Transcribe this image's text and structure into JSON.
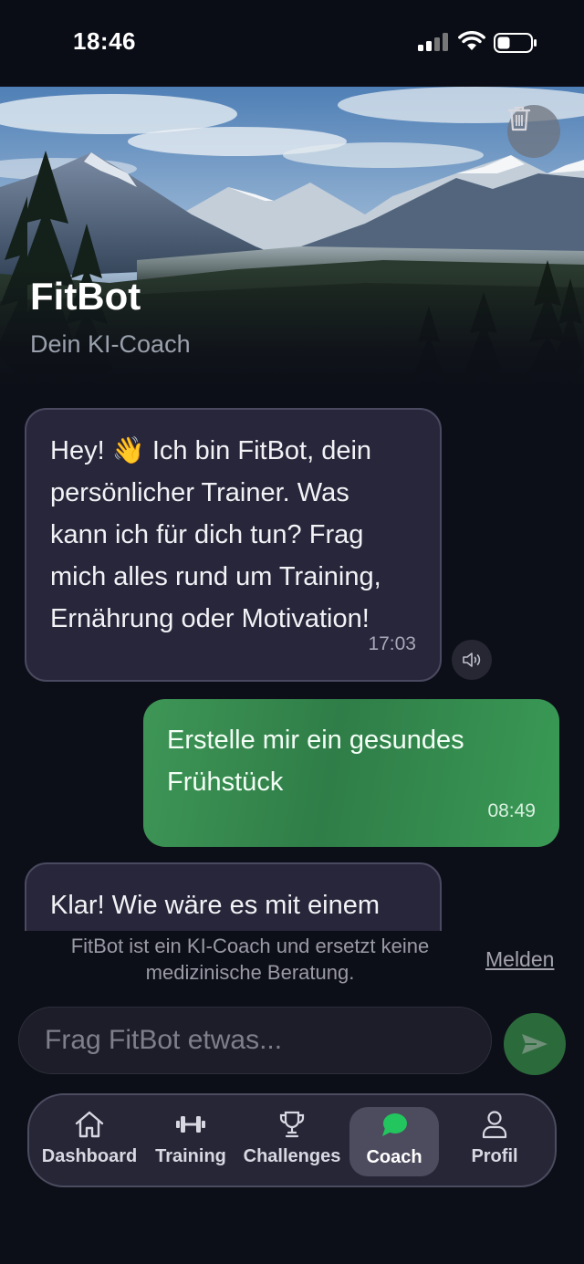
{
  "status_bar": {
    "time": "18:46"
  },
  "header": {
    "title": "FitBot",
    "subtitle": "Dein KI-Coach"
  },
  "messages": [
    {
      "role": "bot",
      "lines": [
        "Hey! 👋 Ich bin FitBot, dein",
        "persönlicher Trainer. Was",
        "kann ich für dich tun? Frag",
        "mich alles rund um Training,",
        "Ernährung oder Motivation!"
      ],
      "time": "17:03"
    },
    {
      "role": "user",
      "lines": [
        "Erstelle mir ein gesundes",
        "Frühstück"
      ],
      "time": "08:49"
    },
    {
      "role": "bot",
      "lines": [
        "Klar! Wie wäre es mit einem"
      ]
    }
  ],
  "disclaimer": {
    "line1": "FitBot ist ein KI-Coach und ersetzt keine",
    "line2": "medizinische Beratung.",
    "report": "Melden"
  },
  "input": {
    "placeholder": "Frag FitBot etwas..."
  },
  "tabs": [
    {
      "label": "Dashboard",
      "icon": "home-icon"
    },
    {
      "label": "Training",
      "icon": "dumbbell-icon"
    },
    {
      "label": "Challenges",
      "icon": "trophy-icon"
    },
    {
      "label": "Coach",
      "icon": "chat-bubble-icon",
      "active": true
    },
    {
      "label": "Profil",
      "icon": "person-icon"
    }
  ],
  "colors": {
    "accent_green": "#3a9a55",
    "bubble_bot": "#27263a",
    "background": "#0d0f18"
  }
}
